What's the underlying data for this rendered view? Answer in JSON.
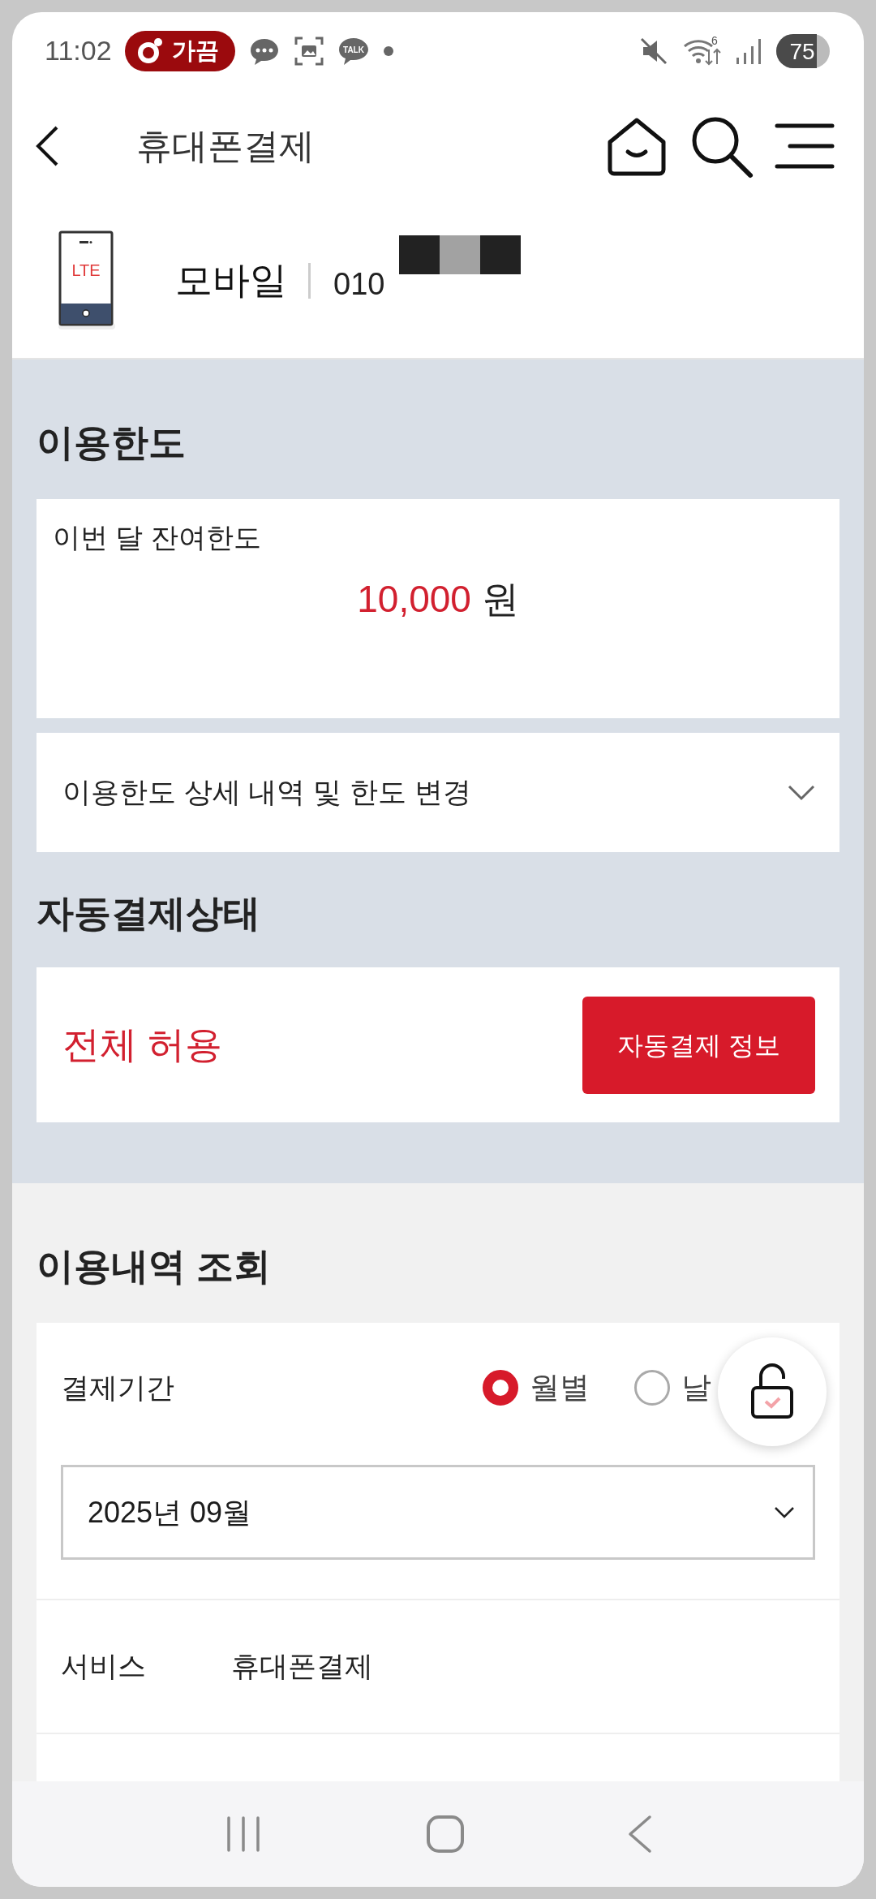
{
  "status_bar": {
    "time": "11:02",
    "pill_label": "가끔",
    "talk_label": "TALK",
    "wifi_label": "6",
    "battery": "75"
  },
  "header": {
    "title": "휴대폰결제"
  },
  "device": {
    "badge": "LTE",
    "type": "모바일",
    "number": "010"
  },
  "limit": {
    "heading": "이용한도",
    "label": "이번 달 잔여한도",
    "amount": "10,000",
    "unit": "원",
    "detail": {
      "label": "이용한도 상세 내역 및 한도 변경",
      "expanded": false
    }
  },
  "autopay": {
    "heading": "자동결제상태",
    "status": "전체 허용",
    "button": "자동결제 정보"
  },
  "history": {
    "heading": "이용내역 조회",
    "period_label": "결제기간",
    "period_options": [
      {
        "label": "월별",
        "selected": true
      },
      {
        "label": "날",
        "selected": false
      }
    ],
    "month_select": {
      "value": "2025년 09월"
    },
    "service_label": "서비스",
    "service_value": "휴대폰결제"
  }
}
